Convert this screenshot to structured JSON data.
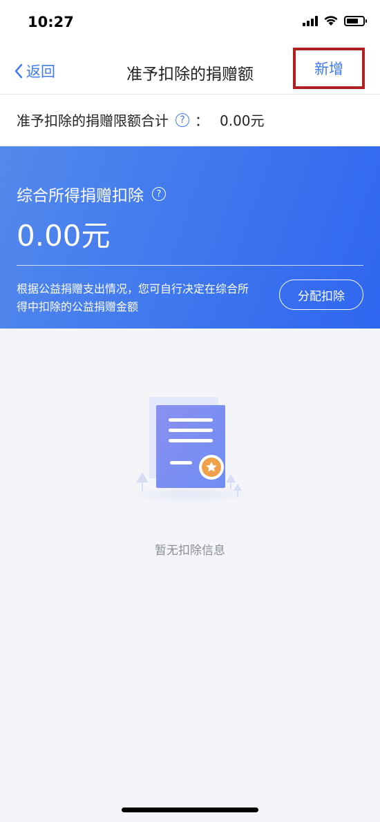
{
  "status_bar": {
    "time": "10:27"
  },
  "nav": {
    "back_label": "返回",
    "title": "准予扣除的捐赠额",
    "add_label": "新增"
  },
  "total": {
    "label": "准予扣除的捐赠限额合计",
    "help_icon": "?",
    "colon": "：",
    "value": "0.00元"
  },
  "card": {
    "title": "综合所得捐赠扣除",
    "help_icon": "?",
    "amount": "0.00元",
    "description": "根据公益捐赠支出情况，您可自行决定在综合所得中扣除的公益捐赠金额",
    "allocate_label": "分配扣除"
  },
  "empty": {
    "text": "暂无扣除信息"
  },
  "colors": {
    "accent": "#3f7af0",
    "card_start": "#5489ec",
    "card_end": "#2f66f0",
    "highlight_border": "#b21f1f"
  },
  "icons": [
    "signal-icon",
    "wifi-icon",
    "battery-icon",
    "back-chevron-icon",
    "help-icon",
    "document-empty-icon"
  ]
}
